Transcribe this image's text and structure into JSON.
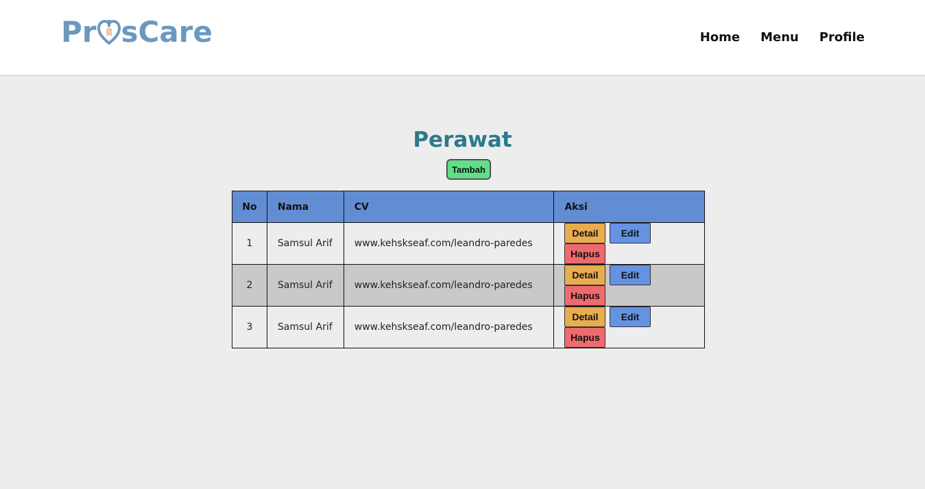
{
  "brand": {
    "logo_text_left": "Pr",
    "logo_text_right": "sCare"
  },
  "nav": {
    "items": [
      "Home",
      "Menu",
      "Profile"
    ]
  },
  "page": {
    "title": "Perawat",
    "add_button": "Tambah"
  },
  "table": {
    "columns": [
      "No",
      "Nama",
      "CV",
      "Aksi"
    ],
    "rows": [
      {
        "no": "1",
        "nama": "Samsul Arif",
        "cv": "www.kehskseaf.com/leandro-paredes"
      },
      {
        "no": "2",
        "nama": "Samsul Arif",
        "cv": "www.kehskseaf.com/leandro-paredes"
      },
      {
        "no": "3",
        "nama": "Samsul Arif",
        "cv": "www.kehskseaf.com/leandro-paredes"
      }
    ],
    "actions": {
      "detail": "Detail",
      "edit": "Edit",
      "delete": "Hapus"
    }
  },
  "colors": {
    "brand": "#6b98c0",
    "title": "#2b7a8c",
    "header": "#628dd2",
    "add": "#5de087",
    "detail": "#e8ad4e",
    "edit": "#6593e2",
    "delete": "#ee6a6f"
  },
  "icons": {
    "logo_mark": "heart-icon"
  }
}
